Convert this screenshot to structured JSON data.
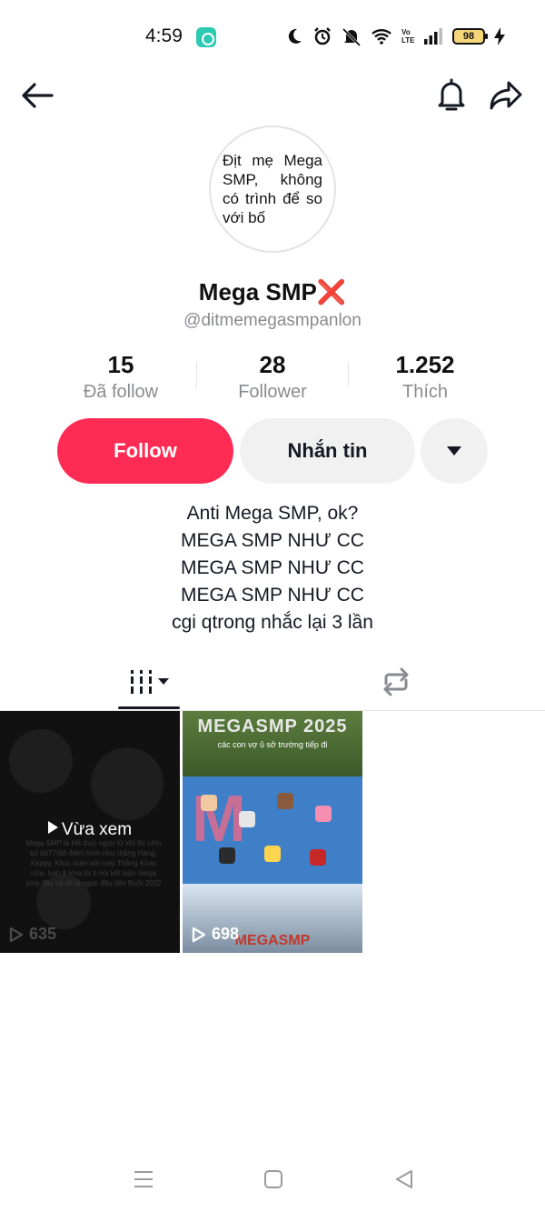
{
  "status_bar": {
    "time": "4:59",
    "battery": "98",
    "network": "Vo LTE"
  },
  "nav": {
    "back_icon": "arrow-left-icon",
    "bell_icon": "bell-icon",
    "share_icon": "share-arrow-icon"
  },
  "profile": {
    "avatar_text": "Địt mẹ Mega SMP, không có trình để so với bố",
    "name": "Mega SMP",
    "name_emoji": "❌",
    "username": "@ditmemegasmpanlon"
  },
  "stats": [
    {
      "value": "15",
      "label": "Đã follow"
    },
    {
      "value": "28",
      "label": "Follower"
    },
    {
      "value": "1.252",
      "label": "Thích"
    }
  ],
  "actions": {
    "follow_label": "Follow",
    "message_label": "Nhắn tin"
  },
  "bio": [
    "Anti Mega SMP, ok?",
    "MEGA SMP NHƯ CC",
    "MEGA SMP NHƯ CC",
    "MEGA SMP NHƯ CC",
    "cgi qtrong nhắc lại 3 lần"
  ],
  "videos": [
    {
      "watched_label": "Vừa xem",
      "views": "635",
      "caption": "Mega SMP là kết thúc ngon từ khi thì nhìn bố 6677/68 điểm hình như thằng Hàng, Kappy, Khoi, toàn với máy Thằng Khác nữa, ban & khoi từ ti nói kết luận mega smp đây và tôi là ngoc đầu tiên Buốt 2022"
    },
    {
      "title": "MEGASMP 2025",
      "subtitle": "các con vợ ủ sở trường tiếp đi",
      "views": "698",
      "footer_title": "MEGASMP"
    }
  ],
  "colors": {
    "follow": "#fe2c55",
    "secondary_button": "#f1f1f2",
    "muted_text": "#8a8b91"
  }
}
